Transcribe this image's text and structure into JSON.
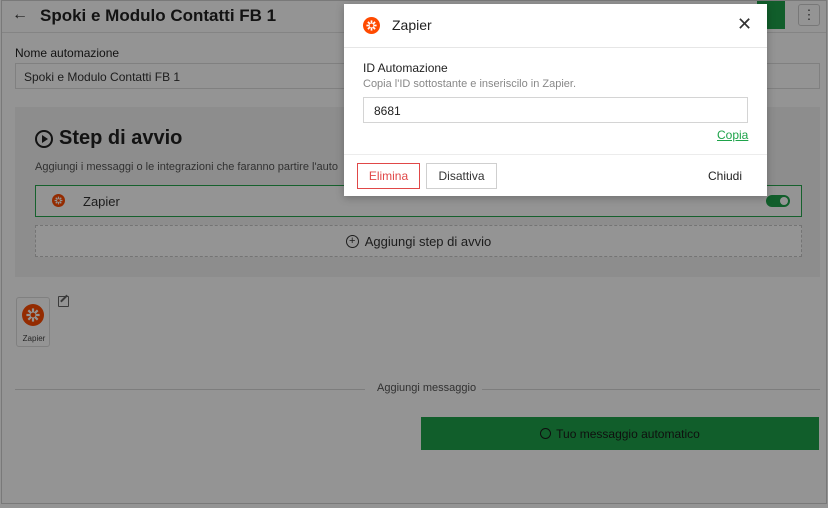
{
  "header": {
    "title": "Spoki e Modulo Contatti FB 1"
  },
  "automation_name": {
    "label": "Nome automazione",
    "value": "Spoki e Modulo Contatti FB 1"
  },
  "start_step": {
    "title": "Step di avvio",
    "description": "Aggiungi i messaggi o le integrazioni che faranno partire l'auto",
    "trigger": {
      "label": "Zapier",
      "enabled": true
    },
    "add_label": "Aggiungi step di avvio"
  },
  "zapier_tile": {
    "label": "Zapier"
  },
  "add_message_label": "Aggiungi messaggio",
  "auto_message_label": "Tuo messaggio automatico",
  "modal": {
    "title": "Zapier",
    "id_label": "ID Automazione",
    "id_help": "Copia l'ID sottostante e inseriscilo in Zapier.",
    "id_value": "8681",
    "copy_label": "Copia",
    "delete_label": "Elimina",
    "disable_label": "Disattiva",
    "close_label": "Chiudi"
  },
  "colors": {
    "accent": "#1ea34a",
    "danger": "#e04848",
    "zapier": "#ff4a00"
  },
  "icons": [
    "back-arrow-icon",
    "more-vertical-icon",
    "play-circle-icon",
    "zapier-icon",
    "plus-circle-icon",
    "edit-icon",
    "smile-icon",
    "close-icon"
  ]
}
